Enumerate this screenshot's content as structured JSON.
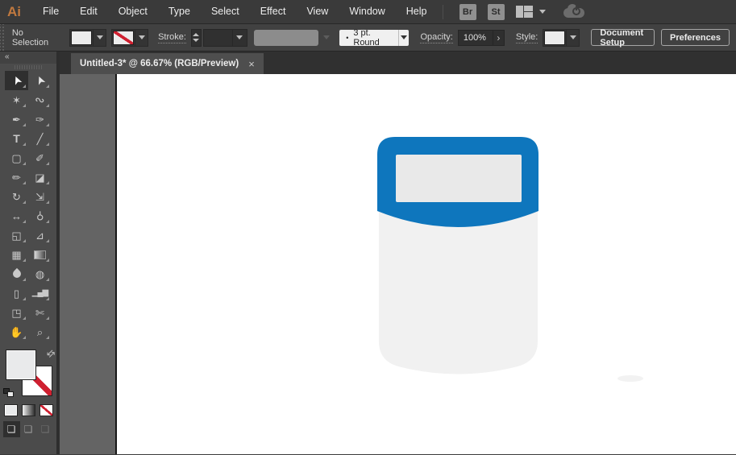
{
  "menubar": {
    "logo": "Ai",
    "items": [
      "File",
      "Edit",
      "Object",
      "Type",
      "Select",
      "Effect",
      "View",
      "Window",
      "Help"
    ],
    "bridge_button": "Br",
    "stock_button": "St"
  },
  "controlbar": {
    "selection_status": "No Selection",
    "stroke_label": "Stroke:",
    "stroke_weight_preview": "•",
    "variable_width_profile_value": "3 pt. Round",
    "opacity_label": "Opacity:",
    "opacity_value": "100%",
    "opacity_arrow_glyph": "›",
    "style_label": "Style:",
    "document_setup_button": "Document Setup",
    "preferences_button": "Preferences"
  },
  "document_tab": {
    "title": "Untitled-3* @ 66.67% (RGB/Preview)",
    "close_glyph": "×"
  },
  "toolbar": {
    "collapse_glyph": "«",
    "tools": [
      {
        "name": "selection-tool",
        "glyph": "➤"
      },
      {
        "name": "direct-selection-tool",
        "glyph": "➤"
      },
      {
        "name": "magic-wand-tool",
        "glyph": "✶"
      },
      {
        "name": "lasso-tool",
        "glyph": "∾"
      },
      {
        "name": "pen-tool",
        "glyph": "✒"
      },
      {
        "name": "curvature-tool",
        "glyph": "✑"
      },
      {
        "name": "type-tool",
        "glyph": "T"
      },
      {
        "name": "line-segment-tool",
        "glyph": "╱"
      },
      {
        "name": "rectangle-tool",
        "glyph": "▢"
      },
      {
        "name": "paintbrush-tool",
        "glyph": "✐"
      },
      {
        "name": "shaper-tool",
        "glyph": "✏"
      },
      {
        "name": "eraser-tool",
        "glyph": "◪"
      },
      {
        "name": "rotate-tool",
        "glyph": "↻"
      },
      {
        "name": "scale-tool",
        "glyph": "⇲"
      },
      {
        "name": "width-tool",
        "glyph": "↔"
      },
      {
        "name": "puppet-warp-tool",
        "glyph": "⚲"
      },
      {
        "name": "shape-builder-tool",
        "glyph": "◱"
      },
      {
        "name": "perspective-grid-tool",
        "glyph": "⊿"
      },
      {
        "name": "mesh-tool",
        "glyph": "▦"
      },
      {
        "name": "gradient-tool",
        "glyph": "▥"
      },
      {
        "name": "eyedropper-tool",
        "glyph": ""
      },
      {
        "name": "blend-tool",
        "glyph": "◍"
      },
      {
        "name": "symbol-sprayer-tool",
        "glyph": "▯"
      },
      {
        "name": "column-graph-tool",
        "glyph": "▁▄▆"
      },
      {
        "name": "artboard-tool",
        "glyph": "◳"
      },
      {
        "name": "slice-tool",
        "glyph": "✄"
      },
      {
        "name": "hand-tool",
        "glyph": "✋"
      },
      {
        "name": "zoom-tool",
        "glyph": "⌕"
      }
    ],
    "swap_fill_stroke_glyph": "⇆",
    "draw_mode_glyph": "❏"
  },
  "colors": {
    "artwork_blue": "#0e76bd",
    "artwork_screen": "#e9e9e9",
    "artwork_body": "#f1f1f1",
    "artwork_smudge": "#ededed",
    "none_slash_red": "#cf2030"
  }
}
